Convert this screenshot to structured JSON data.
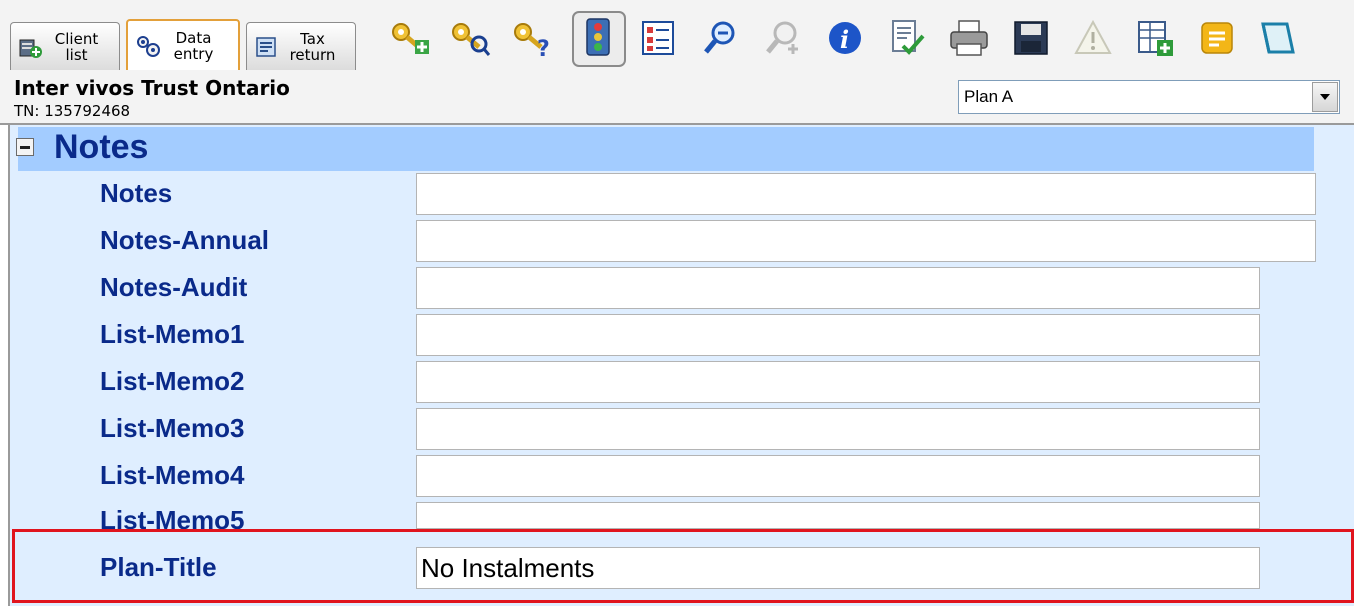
{
  "tabs": [
    {
      "label": "Client list",
      "icon": "client-list-icon"
    },
    {
      "label": "Data entry",
      "icon": "data-entry-icon",
      "active": true
    },
    {
      "label": "Tax return",
      "icon": "tax-return-icon"
    }
  ],
  "toolbar": [
    {
      "name": "key-add-icon"
    },
    {
      "name": "key-search-icon"
    },
    {
      "name": "key-help-icon"
    },
    {
      "name": "traffic-light-icon",
      "selected": true
    },
    {
      "name": "checklist-icon"
    },
    {
      "name": "zoom-out-icon"
    },
    {
      "name": "zoom-in-icon",
      "disabled": true
    },
    {
      "name": "info-icon"
    },
    {
      "name": "review-check-icon"
    },
    {
      "name": "printer-icon"
    },
    {
      "name": "save-icon"
    },
    {
      "name": "warning-icon",
      "disabled": true
    },
    {
      "name": "add-form-icon"
    },
    {
      "name": "memo-icon"
    },
    {
      "name": "exit-icon"
    }
  ],
  "client": {
    "name": "Inter vivos Trust Ontario",
    "tn": "TN: 135792468"
  },
  "plan_selector": {
    "value": "Plan A"
  },
  "section": {
    "title": "Notes",
    "expanded": true
  },
  "fields": [
    {
      "label": "Notes",
      "value": ""
    },
    {
      "label": "Notes-Annual",
      "value": ""
    },
    {
      "label": "Notes-Audit",
      "value": ""
    },
    {
      "label": "List-Memo1",
      "value": ""
    },
    {
      "label": "List-Memo2",
      "value": ""
    },
    {
      "label": "List-Memo3",
      "value": ""
    },
    {
      "label": "List-Memo4",
      "value": ""
    },
    {
      "label": "List-Memo5",
      "value": ""
    },
    {
      "label": "Plan-Title",
      "value": "No Instalments"
    }
  ],
  "colors": {
    "accent_blue": "#0a2a8a",
    "section_header": "#a3ccff",
    "content_bg": "#dfeeff",
    "highlight": "#e0141e"
  }
}
